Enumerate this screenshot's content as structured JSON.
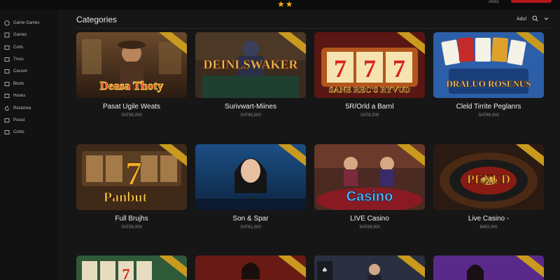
{
  "header": {
    "account_text": "Aniss"
  },
  "sidebar": {
    "items": [
      {
        "label": "Game Games",
        "icon": "circle-check-icon"
      },
      {
        "label": "Games",
        "icon": "grid-icon"
      },
      {
        "label": "Corls",
        "icon": "box-icon"
      },
      {
        "label": "Truss",
        "icon": "box-icon"
      },
      {
        "label": "Casson",
        "icon": "box-icon"
      },
      {
        "label": "Boots",
        "icon": "box-icon"
      },
      {
        "label": "Hooes",
        "icon": "box-icon"
      },
      {
        "label": "Resterive",
        "icon": "refresh-icon"
      },
      {
        "label": "Poiust",
        "icon": "box-icon"
      },
      {
        "label": "Conts",
        "icon": "box-icon"
      }
    ]
  },
  "main": {
    "title": "Categories",
    "tools": {
      "select_label": "Adol"
    },
    "cards": [
      {
        "title": "Pasat Ugile Weats",
        "price": "SAT65,000",
        "art": "Deasa Thoty",
        "theme": "western"
      },
      {
        "title": "Surivwart-Miines",
        "price": "SAT65,000",
        "art": "DEINLSWAKER",
        "theme": "poker"
      },
      {
        "title": "5R/Orld a Barnl",
        "price": "SAT8,200",
        "art": "SANE REC'S RYVUD",
        "theme": "slots777"
      },
      {
        "title": "Cleld Tirrite Peglanrs",
        "price": "SAT69,000",
        "art": "DRALUO ROSENUS",
        "theme": "cards"
      },
      {
        "title": "Full Brujhs",
        "price": "SAT56,003",
        "art": "Panbut",
        "theme": "slots7"
      },
      {
        "title": "Son & Spar",
        "price": "SAT61,000",
        "art": "",
        "theme": "dealer"
      },
      {
        "title": "LIVE Casino",
        "price": "SAT69,000",
        "art": "Casino",
        "theme": "livecasino"
      },
      {
        "title": "Live Casino -",
        "price": "$493,000",
        "art": "PEXUD",
        "theme": "roulette"
      },
      {
        "title": "",
        "price": "",
        "art": "",
        "theme": "slotsmini"
      },
      {
        "title": "",
        "price": "",
        "art": "",
        "theme": "redroom"
      },
      {
        "title": "",
        "price": "",
        "art": "",
        "theme": "suits"
      },
      {
        "title": "",
        "price": "",
        "art": "",
        "theme": "purple"
      }
    ]
  }
}
